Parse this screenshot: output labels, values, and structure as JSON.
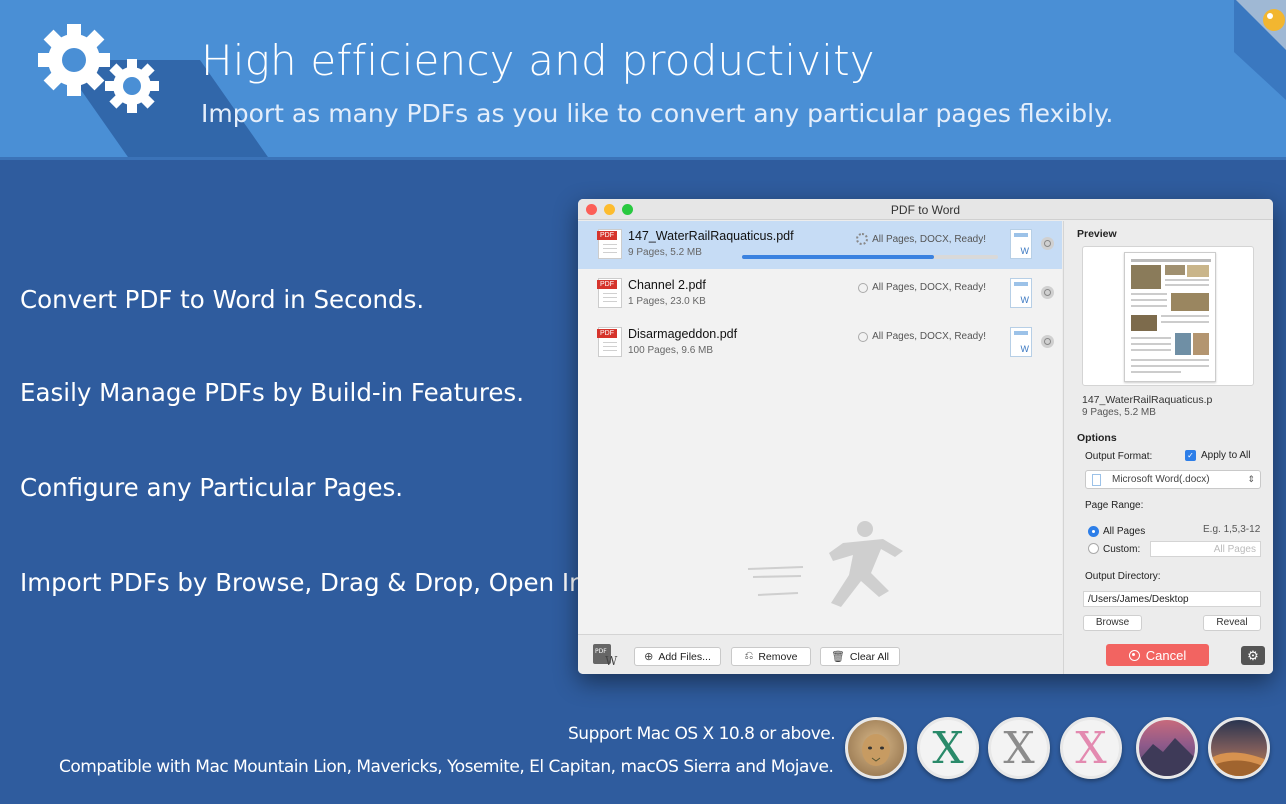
{
  "banner": {
    "title": "High efficiency and productivity",
    "subtitle": "Import as many PDFs as you like to convert any particular pages flexibly."
  },
  "features": [
    "Convert PDF to Word in Seconds.",
    "Easily Manage PDFs by Build-in Features.",
    "Configure any Particular Pages.",
    "Import PDFs by Browse, Drag & Drop, Open In."
  ],
  "window": {
    "title": "PDF to Word",
    "files": [
      {
        "name": "147_WaterRailRaquaticus.pdf",
        "meta": "9 Pages, 5.2 MB",
        "status": "All Pages, DOCX, Ready!",
        "progress": 0.75,
        "selected": true
      },
      {
        "name": "Channel 2.pdf",
        "meta": "1 Pages, 23.0 KB",
        "status": "All Pages, DOCX, Ready!"
      },
      {
        "name": "Disarmageddon.pdf",
        "meta": "100 Pages, 9.6 MB",
        "status": "All Pages, DOCX, Ready!"
      }
    ],
    "file_icon_tag": "PDF",
    "word_icon_letter": "W",
    "toolbar": {
      "add_files": "Add Files...",
      "remove": "Remove",
      "clear_all": "Clear All"
    },
    "preview": {
      "heading": "Preview",
      "file_name": "147_WaterRailRaquaticus.p",
      "file_meta": "9 Pages, 5.2 MB"
    },
    "options": {
      "heading": "Options",
      "output_format_label": "Output Format:",
      "apply_to_all": "Apply to All",
      "format_value": "Microsoft Word(.docx)",
      "page_range_label": "Page Range:",
      "all_pages": "All Pages",
      "example": "E.g. 1,5,3-12",
      "custom": "Custom:",
      "custom_placeholder": "All Pages",
      "output_dir_label": "Output Directory:",
      "output_dir_value": "/Users/James/Desktop",
      "browse": "Browse",
      "reveal": "Reveal",
      "cancel": "Cancel"
    }
  },
  "footer": {
    "support": "Support Mac OS X 10.8 or above.",
    "compat": "Compatible with Mac Mountain Lion, Mavericks, Yosemite, El Capitan, macOS Sierra and Mojave."
  },
  "colors": {
    "banner": "#4a8fd5",
    "background": "#2f5c9e",
    "accent_blue": "#2d7ee8",
    "cancel_red": "#f26461"
  },
  "os_icons": [
    "mountain-lion-icon",
    "mavericks-icon",
    "yosemite-icon",
    "el-capitan-icon",
    "sierra-icon",
    "mojave-icon"
  ]
}
